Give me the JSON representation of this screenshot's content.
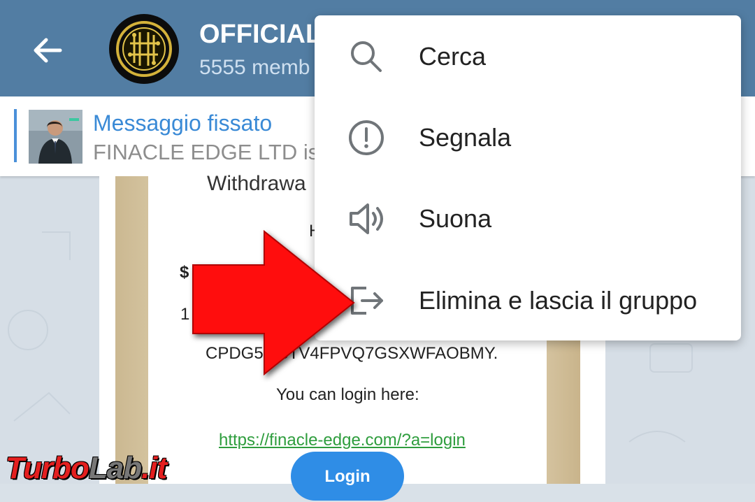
{
  "header": {
    "title": "OFFICIAL",
    "subtitle": "5555 memb",
    "bg_color": "#527da3"
  },
  "pinned": {
    "title": "Messaggio fissato",
    "text": "FINACLE EDGE LTD is"
  },
  "message_card": {
    "line1": "Withdrawa",
    "line2": "H",
    "line3": "$",
    "line4": "1",
    "line5": "CPDG5V   6TV4FPVQ7GSXWFAOBMY.",
    "line6": "You can login here:",
    "link": "https://finacle-edge.com/?a=login",
    "button_label": "Login"
  },
  "context_menu": {
    "items": [
      {
        "label": "Cerca",
        "icon": "search-icon"
      },
      {
        "label": "Segnala",
        "icon": "report-icon"
      },
      {
        "label": "Suona",
        "icon": "volume-icon"
      },
      {
        "label": "Elimina e lascia il gruppo",
        "icon": "leave-icon"
      }
    ]
  },
  "watermark": {
    "part1": "Turbo",
    "part2": "Lab",
    "part3": ".it"
  },
  "colors": {
    "accent": "#3a8ad6",
    "arrow": "#ff0000",
    "link": "#2e9d3d"
  }
}
